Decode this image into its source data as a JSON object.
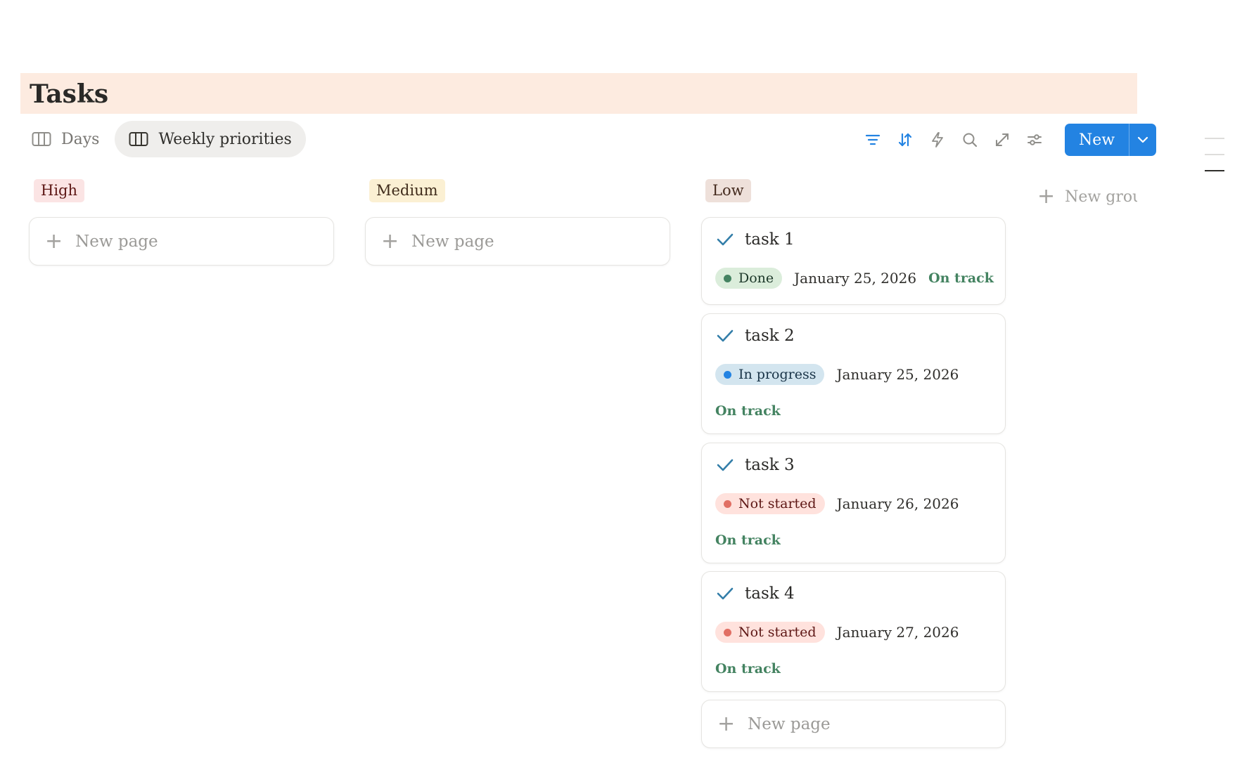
{
  "page": {
    "title": "Tasks"
  },
  "views": [
    {
      "label": "Days",
      "icon": "board-icon",
      "active": false
    },
    {
      "label": "Weekly priorities",
      "icon": "board-icon",
      "active": true
    }
  ],
  "toolbar": {
    "icons": [
      "filter-icon",
      "sort-icon",
      "automation-icon",
      "search-icon",
      "expand-icon",
      "settings-icon"
    ],
    "new_label": "New",
    "accent": "#2383e2"
  },
  "groups": [
    {
      "label": "High",
      "bg": "#fbe4e4",
      "fg": "#5d1715"
    },
    {
      "label": "Medium",
      "bg": "#fbf0d3",
      "fg": "#402c1b"
    },
    {
      "label": "Low",
      "bg": "#eee0da",
      "fg": "#442a1e"
    }
  ],
  "new_page_label": "New page",
  "new_group_label": "New group",
  "tasks": [
    {
      "name": "task 1",
      "status": "Done",
      "status_bg": "#dbeddb",
      "status_dot": "#448361",
      "status_fg": "#1c3829",
      "date": "January 25, 2026",
      "track": "On track"
    },
    {
      "name": "task 2",
      "status": "In progress",
      "status_bg": "#d3e5ef",
      "status_dot": "#2383e2",
      "status_fg": "#183347",
      "date": "January 25, 2026",
      "track": "On track"
    },
    {
      "name": "task 3",
      "status": "Not started",
      "status_bg": "#ffe2dd",
      "status_dot": "#e16f64",
      "status_fg": "#5d1715",
      "date": "January 26, 2026",
      "track": "On track"
    },
    {
      "name": "task 4",
      "status": "Not started",
      "status_bg": "#ffe2dd",
      "status_dot": "#e16f64",
      "status_fg": "#5d1715",
      "date": "January 27, 2026",
      "track": "On track"
    }
  ]
}
